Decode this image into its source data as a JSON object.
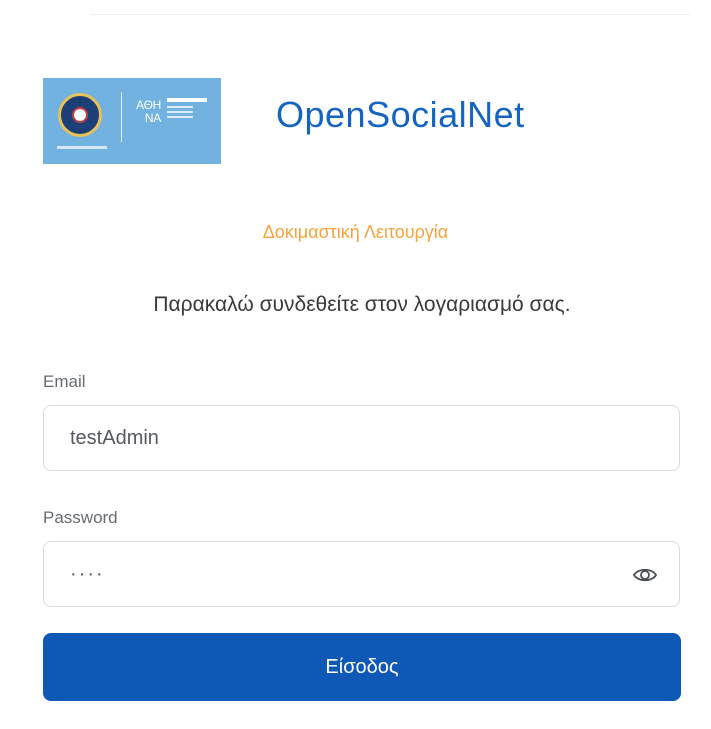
{
  "app": {
    "name": "OpenSocialNet",
    "logo_text": "ΑΘΗ ΝΑ"
  },
  "banner": {
    "test_mode": "Δοκιμαστική Λειτουργία"
  },
  "login": {
    "instructions": "Παρακαλώ συνδεθείτε στον λογαριασμό σας.",
    "email_label": "Email",
    "email_value": "testAdmin",
    "password_label": "Password",
    "password_value": "····",
    "submit_label": "Είσοδος",
    "password_toggle_icon": "eye-icon"
  },
  "colors": {
    "brand_blue": "#1565c0",
    "button_blue": "#0d59b5",
    "test_mode_orange": "#f5a43a",
    "logo_background": "#72b2e0"
  }
}
